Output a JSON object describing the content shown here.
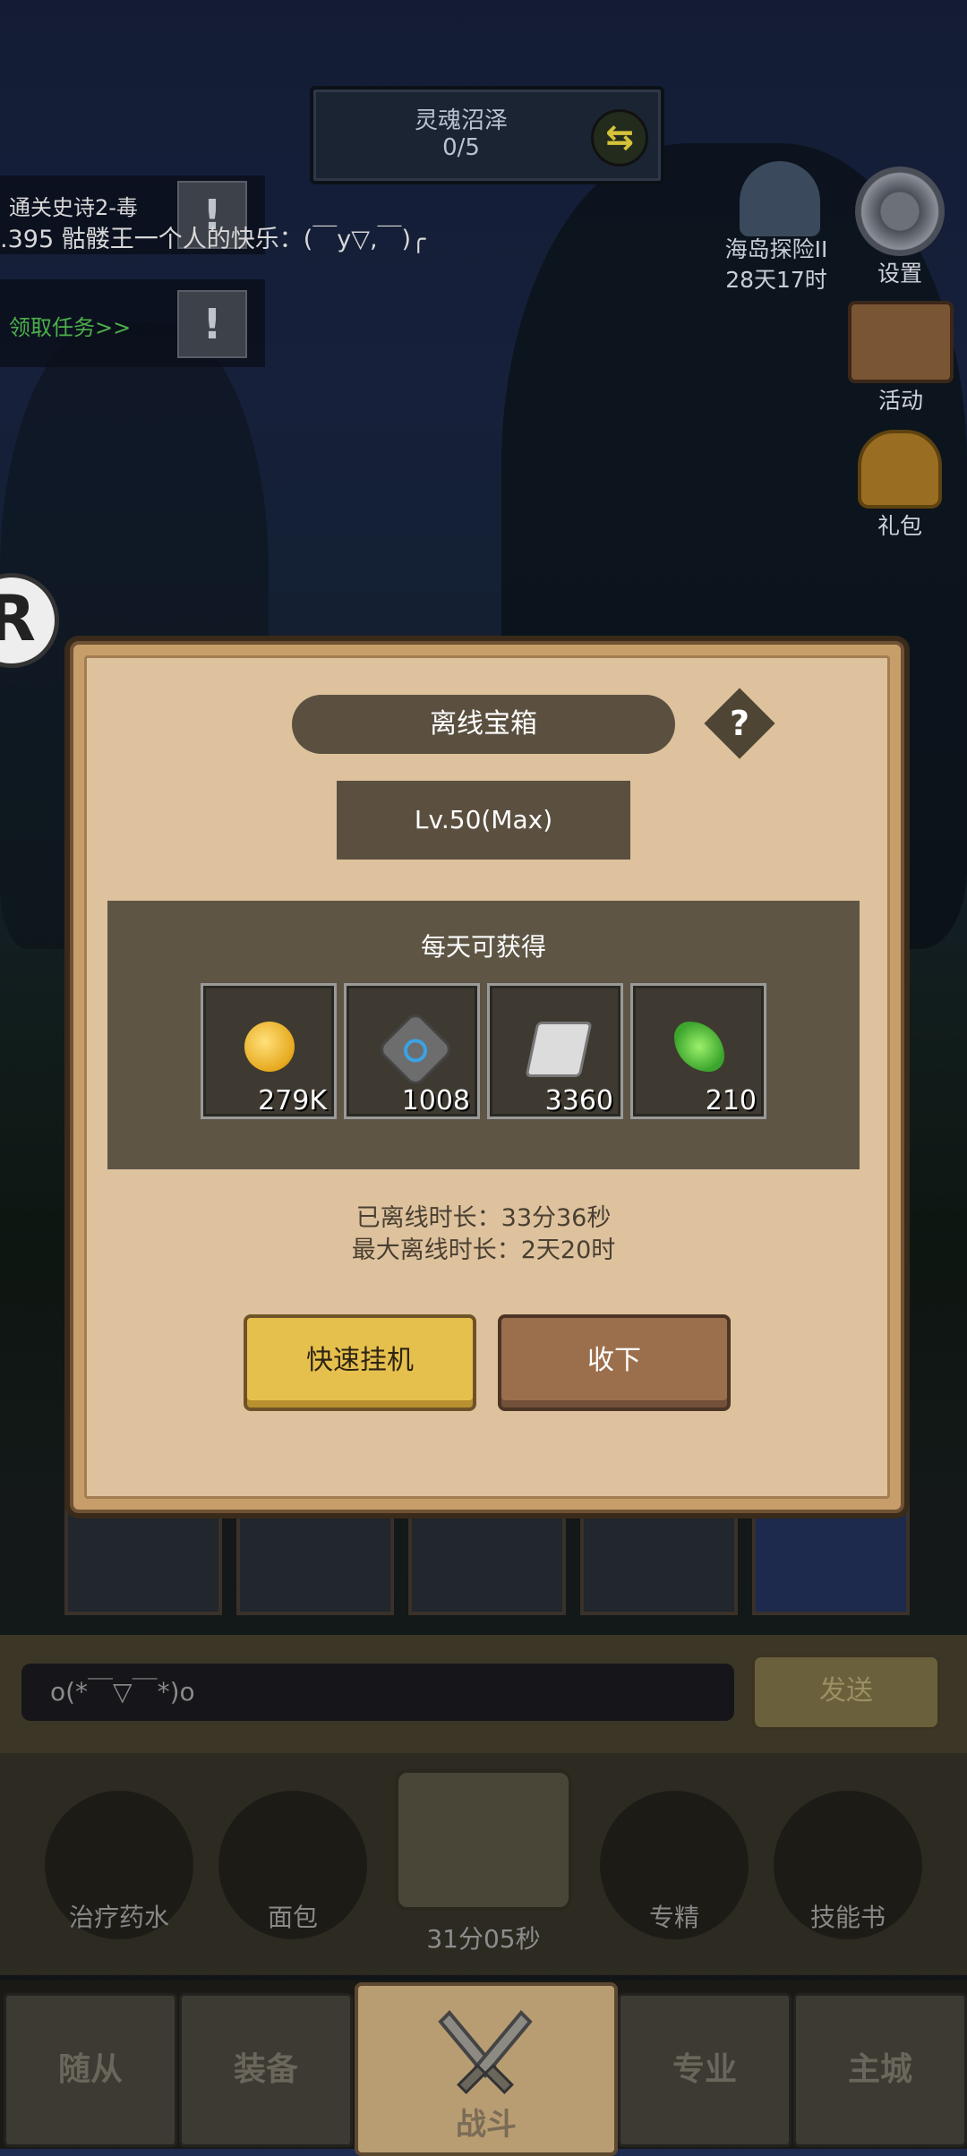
{
  "hud": {
    "stage_name": "灵魂沼泽",
    "stage_progress": "0/5",
    "quests": [
      {
        "text": "通关史诗2-毒",
        "color": "#d7d7d7"
      },
      {
        "text": "领取任务>>",
        "color": "#4caf4a"
      }
    ],
    "chat_ticker": ".395 骷髅王一个人的快乐：(￣y▽,￣)╭",
    "island": {
      "name": "海岛探险II",
      "time": "28天17时"
    },
    "right_menu": {
      "settings": "设置",
      "events": "活动",
      "gift": "礼包"
    },
    "r_badge": "R"
  },
  "dialog": {
    "title": "离线宝箱",
    "help": "?",
    "level": "Lv.50(Max)",
    "rewards_header": "每天可获得",
    "rewards": [
      {
        "icon": "gold-coin-icon",
        "amount": "279K"
      },
      {
        "icon": "rune-stone-icon",
        "amount": "1008"
      },
      {
        "icon": "scroll-icon",
        "amount": "3360"
      },
      {
        "icon": "clover-icon",
        "amount": "210"
      }
    ],
    "offline_duration": "已离线时长：33分36秒",
    "max_offline": "最大离线时长：2天20时",
    "btn_quick": "快速挂机",
    "btn_collect": "收下"
  },
  "chat": {
    "input_value": "o(*￣▽￣*)o",
    "send": "发送"
  },
  "items": {
    "potion": "治疗药水",
    "bread": "面包",
    "chest_timer": "31分05秒",
    "mastery": "专精",
    "skillbook": "技能书"
  },
  "tabs": {
    "followers": "随从",
    "equipment": "装备",
    "battle": "战斗",
    "profession": "专业",
    "city": "主城"
  }
}
